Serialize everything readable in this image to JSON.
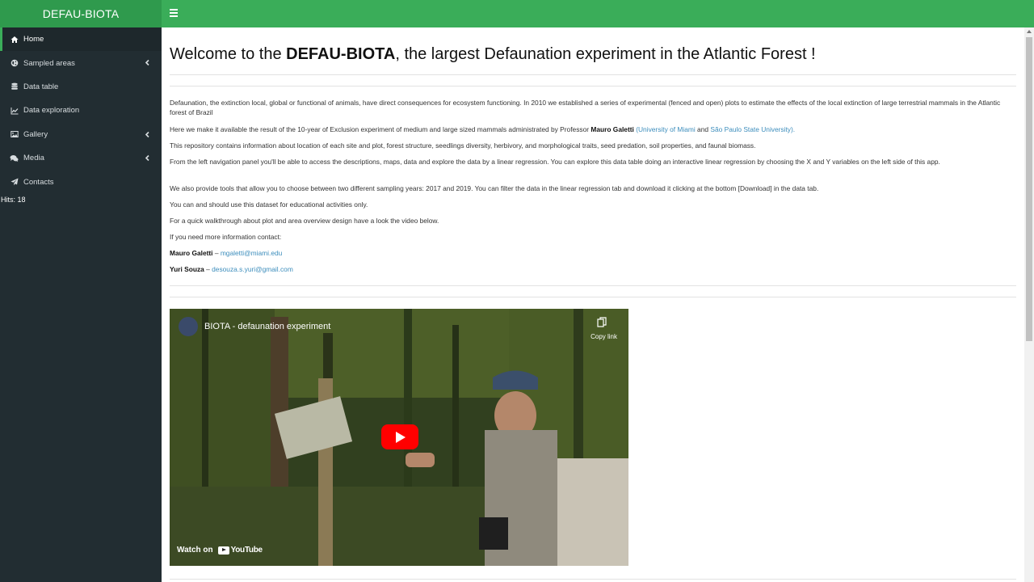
{
  "app": {
    "title": "DEFAU-BIOTA"
  },
  "sidebar": {
    "items": [
      {
        "label": "Home",
        "icon": "home-icon",
        "active": true
      },
      {
        "label": "Sampled areas",
        "icon": "globe-icon",
        "has_submenu": true
      },
      {
        "label": "Data table",
        "icon": "database-icon"
      },
      {
        "label": "Data exploration",
        "icon": "line-chart-icon"
      },
      {
        "label": "Gallery",
        "icon": "image-icon",
        "has_submenu": true
      },
      {
        "label": "Media",
        "icon": "comments-icon",
        "has_submenu": true
      },
      {
        "label": "Contacts",
        "icon": "paper-plane-icon"
      }
    ],
    "hits": "Hits: 18"
  },
  "main": {
    "title_prefix": "Welcome to the ",
    "title_bold": "DEFAU-BIOTA",
    "title_suffix": ", the largest Defaunation experiment in the Atlantic Forest !",
    "p1": "Defaunation, the extinction local, global or functional of animals, have direct consequences for ecosystem functioning. In 2010 we established a series of experimental (fenced and open) plots to estimate the effects of the local extinction of large terrestrial mammals in the Atlantic forest of Brazil",
    "p2_a": "Here we make it available the result of the 10-year of Exclusion experiment of medium and large sized mammals administrated by Professor ",
    "p2_name": "Mauro Galetti",
    "p2_open": " (",
    "p2_link1": "University of Miami",
    "p2_and": " and ",
    "p2_link2": "São Paulo State University",
    "p2_close": ").",
    "p3": "This repository contains information about location of each site and plot, forest structure, seedlings diversity, herbivory, and morphological traits, seed predation, soil properties, and faunal biomass.",
    "p4": "From the left navigation panel you'll be able to access the descriptions, maps, data and explore the data by a linear regression. You can explore this data table doing an interactive linear regression by choosing the X and Y variables on the left side of this app.",
    "p5": "We also provide tools that allow you to choose between two different sampling years: 2017 and 2019. You can filter the data in the linear regression tab and download it clicking at the bottom [Download] in the data tab.",
    "p6": "You can and should use this dataset for educational activities only.",
    "p7": "For a quick walkthrough about plot and area overview design have a look the video below.",
    "p8": "If you need more information contact:",
    "contact1_name": "Mauro Galetti",
    "contact1_sep": " – ",
    "contact1_email": "mgaletti@miami.edu",
    "contact2_name": "Yuri Souza",
    "contact2_sep": " – ",
    "contact2_email": "desouza.s.yuri@gmail.com"
  },
  "video": {
    "title": "BIOTA - defaunation experiment",
    "copy_link": "Copy link",
    "watch_on": "Watch on",
    "youtube": "YouTube"
  },
  "colors": {
    "header": "#3aad59",
    "logo": "#2f9a4d",
    "sidebar": "#222d32",
    "link": "#3c8dbc",
    "play": "#ff0000"
  }
}
